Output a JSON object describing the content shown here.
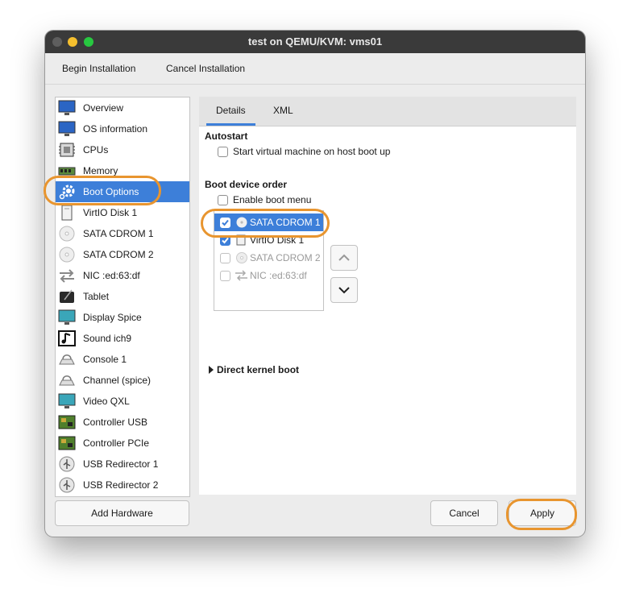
{
  "window": {
    "title": "test on QEMU/KVM: vms01"
  },
  "menubar": {
    "begin_installation": "Begin Installation",
    "cancel_installation": "Cancel Installation"
  },
  "sidebar": {
    "items": [
      {
        "label": "Overview",
        "icon": "monitor-icon"
      },
      {
        "label": "OS information",
        "icon": "monitor-icon"
      },
      {
        "label": "CPUs",
        "icon": "cpu-icon"
      },
      {
        "label": "Memory",
        "icon": "memory-icon"
      },
      {
        "label": "Boot Options",
        "icon": "gear-icon",
        "selected": true
      },
      {
        "label": "VirtIO Disk 1",
        "icon": "disk-icon"
      },
      {
        "label": "SATA CDROM 1",
        "icon": "cdrom-icon"
      },
      {
        "label": "SATA CDROM 2",
        "icon": "cdrom-icon"
      },
      {
        "label": "NIC :ed:63:df",
        "icon": "network-icon"
      },
      {
        "label": "Tablet",
        "icon": "tablet-icon"
      },
      {
        "label": "Display Spice",
        "icon": "display-icon"
      },
      {
        "label": "Sound ich9",
        "icon": "sound-icon"
      },
      {
        "label": "Console 1",
        "icon": "console-icon"
      },
      {
        "label": "Channel (spice)",
        "icon": "channel-icon"
      },
      {
        "label": "Video QXL",
        "icon": "video-icon"
      },
      {
        "label": "Controller USB",
        "icon": "controller-icon"
      },
      {
        "label": "Controller PCIe",
        "icon": "controller-icon"
      },
      {
        "label": "USB Redirector 1",
        "icon": "usb-icon"
      },
      {
        "label": "USB Redirector 2",
        "icon": "usb-icon"
      }
    ],
    "add_hardware": "Add Hardware"
  },
  "tabs": {
    "details": "Details",
    "xml": "XML"
  },
  "autostart": {
    "title": "Autostart",
    "start_on_boot": "Start virtual machine on host boot up",
    "checked": false
  },
  "boot_order": {
    "title": "Boot device order",
    "enable_boot_menu": "Enable boot menu",
    "enable_boot_menu_checked": false,
    "devices": [
      {
        "label": "SATA CDROM 1",
        "checked": true,
        "selected": true,
        "icon": "cdrom-icon"
      },
      {
        "label": "VirtIO Disk 1",
        "checked": true,
        "selected": false,
        "icon": "disk-icon"
      },
      {
        "label": "SATA CDROM 2",
        "checked": false,
        "selected": false,
        "icon": "cdrom-icon",
        "disabled": true
      },
      {
        "label": "NIC :ed:63:df",
        "checked": false,
        "selected": false,
        "icon": "network-icon",
        "disabled": true
      }
    ]
  },
  "direct_kernel_boot": {
    "label": "Direct kernel boot",
    "expanded": false
  },
  "buttons": {
    "cancel": "Cancel",
    "apply": "Apply"
  },
  "colors": {
    "accent": "#3d7fd9",
    "highlight_ring": "#e8952f",
    "titlebar": "#3a3a3a"
  }
}
